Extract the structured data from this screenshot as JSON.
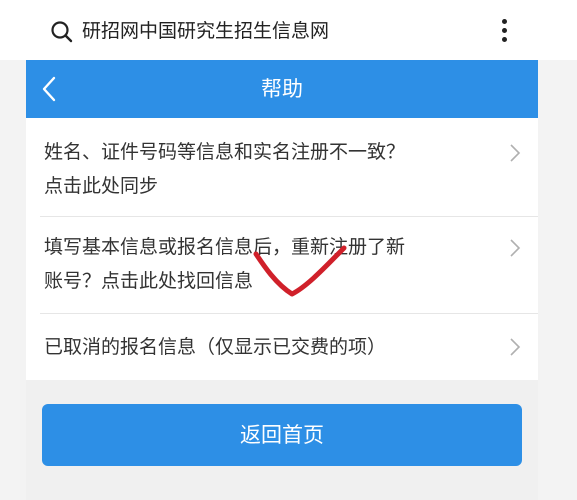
{
  "search_bar": {
    "text": "研招网中国研究生招生信息网",
    "icon": "search-icon",
    "menu_icon": "more-vertical-icon"
  },
  "header": {
    "title": "帮助",
    "back_icon": "chevron-left-icon",
    "color": "#2d8fe6"
  },
  "help_items": [
    {
      "line1": "姓名、证件号码等信息和实名注册不一致？",
      "line2": "点击此处同步"
    },
    {
      "line1": "填写基本信息或报名信息后，重新注册了新",
      "line2": "账号？点击此处找回信息"
    },
    {
      "line1": "已取消的报名信息（仅显示已交费的项）",
      "line2": ""
    }
  ],
  "home_button": {
    "label": "返回首页"
  },
  "colors": {
    "accent": "#2d8fe6",
    "annotation": "#d0202a"
  }
}
